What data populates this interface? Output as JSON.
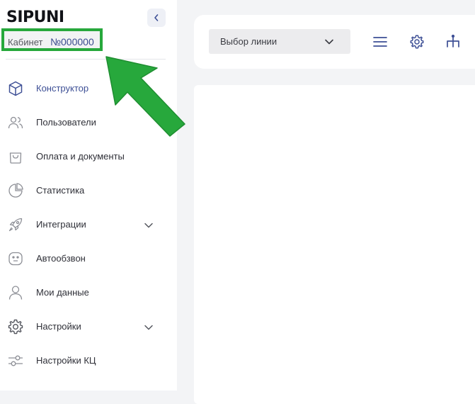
{
  "brand": {
    "logo_text": "SIPUNI"
  },
  "cabinet": {
    "label": "Кабинет",
    "number": "№000000"
  },
  "sidebar": {
    "items": [
      {
        "label": "Конструктор",
        "icon": "cube-icon",
        "active": true
      },
      {
        "label": "Пользователи",
        "icon": "users-icon"
      },
      {
        "label": "Оплата и документы",
        "icon": "bag-icon"
      },
      {
        "label": "Статистика",
        "icon": "pie-chart-icon"
      },
      {
        "label": "Интеграции",
        "icon": "rocket-icon",
        "expandable": true
      },
      {
        "label": "Автообзвон",
        "icon": "robot-face-icon"
      },
      {
        "label": "Мои данные",
        "icon": "user-icon"
      },
      {
        "label": "Настройки",
        "icon": "gear-icon",
        "expandable": true
      },
      {
        "label": "Настройки КЦ",
        "icon": "sliders-icon"
      }
    ]
  },
  "toolbar": {
    "line_select_placeholder": "Выбор линии",
    "icons": [
      "menu-icon",
      "gear-icon",
      "hierarchy-icon"
    ]
  },
  "colors": {
    "accent": "#3d4f95",
    "highlight": "#27a83c",
    "background": "#f3f4f6"
  }
}
